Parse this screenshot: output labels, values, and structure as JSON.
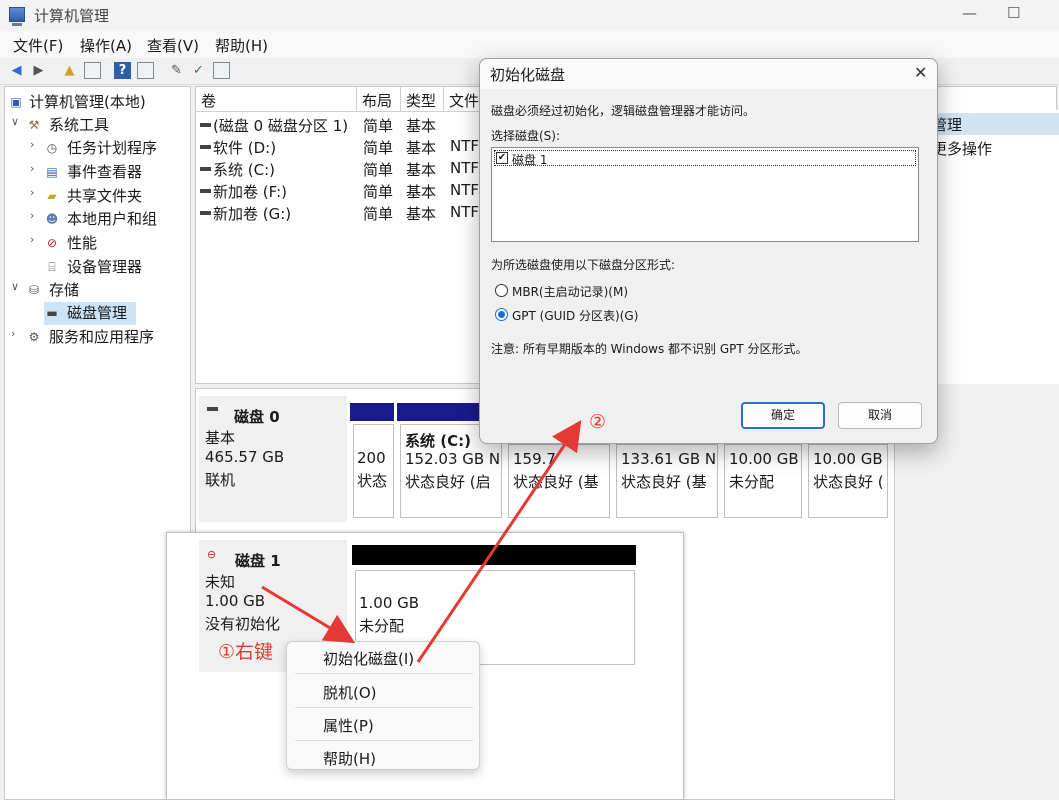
{
  "window": {
    "title": "计算机管理"
  },
  "menu": [
    "文件(F)",
    "操作(A)",
    "查看(V)",
    "帮助(H)"
  ],
  "tree": {
    "root": "计算机管理(本地)",
    "system_tools": "系统工具",
    "task_scheduler": "任务计划程序",
    "event_viewer": "事件查看器",
    "shared_folders": "共享文件夹",
    "local_users": "本地用户和组",
    "performance": "性能",
    "device_manager": "设备管理器",
    "storage": "存储",
    "disk_management": "磁盘管理",
    "services": "服务和应用程序"
  },
  "volume_list": {
    "headers": [
      "卷",
      "布局",
      "类型",
      "文件"
    ],
    "rows": [
      {
        "name": "(磁盘 0 磁盘分区 1)",
        "layout": "简单",
        "type": "基本",
        "fs": ""
      },
      {
        "name": "软件 (D:)",
        "layout": "简单",
        "type": "基本",
        "fs": "NTF"
      },
      {
        "name": "系统 (C:)",
        "layout": "简单",
        "type": "基本",
        "fs": "NTF"
      },
      {
        "name": "新加卷 (F:)",
        "layout": "简单",
        "type": "基本",
        "fs": "NTF"
      },
      {
        "name": "新加卷 (G:)",
        "layout": "简单",
        "type": "基本",
        "fs": "NTF"
      }
    ]
  },
  "actions": {
    "header": "管理",
    "more": "更多操作"
  },
  "disk0": {
    "name": "磁盘 0",
    "type": "基本",
    "size": "465.57 GB",
    "status": "联机",
    "partitions": [
      {
        "title": "",
        "size": "200",
        "status": "状态"
      },
      {
        "title": "系统 (C:)",
        "size": "152.03 GB N",
        "status": "状态良好 (启"
      },
      {
        "title": "",
        "size": "159.7",
        "status": "状态良好 (基"
      },
      {
        "title": "",
        "size": "133.61 GB N",
        "status": "状态良好 (基"
      },
      {
        "title": "",
        "size": "10.00 GB",
        "status": "未分配"
      },
      {
        "title": "",
        "size": "10.00 GB",
        "status": "状态良好 ("
      }
    ]
  },
  "disk1": {
    "name": "磁盘 1",
    "type": "未知",
    "size": "1.00 GB",
    "status": "没有初始化",
    "partition_size": "1.00 GB",
    "partition_status": "未分配"
  },
  "context_menu": [
    "初始化磁盘(I)",
    "脱机(O)",
    "属性(P)",
    "帮助(H)"
  ],
  "dialog": {
    "title": "初始化磁盘",
    "intro": "磁盘必须经过初始化，逻辑磁盘管理器才能访问。",
    "select_label": "选择磁盘(S):",
    "disk_item": "磁盘 1",
    "style_label": "为所选磁盘使用以下磁盘分区形式:",
    "mbr": "MBR(主启动记录)(M)",
    "gpt": "GPT (GUID 分区表)(G)",
    "note": "注意: 所有早期版本的 Windows 都不识别 GPT 分区形式。",
    "ok": "确定",
    "cancel": "取消",
    "selected_style": "GPT"
  },
  "annotations": {
    "step1": "①右键",
    "step2": "②"
  },
  "colors": {
    "annotation": "#e53935",
    "disk_bar": "#1a1a8c",
    "selection": "#cce4f7"
  }
}
